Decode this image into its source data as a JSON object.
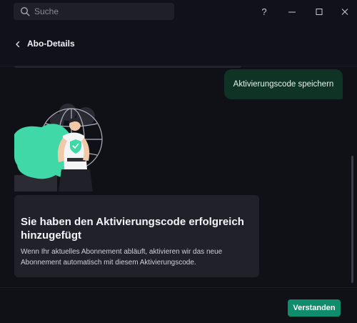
{
  "search": {
    "placeholder": "Suche",
    "icon": "search-icon"
  },
  "window_controls": {
    "help": "?",
    "minimize": "–",
    "maximize": "□",
    "close": "×"
  },
  "header": {
    "title": "Abo-Details",
    "back_icon": "chevron-left-icon"
  },
  "chat": {
    "bubble_text": "Aktivierungscode speichern"
  },
  "card": {
    "title": "Sie haben den Aktivierungscode erfolgreich hinzugefügt",
    "body": "Wenn Ihr aktuelles Abonnement abläuft, aktivieren wir das neue Abonnement automatisch mit diesem Aktivierungscode."
  },
  "footer": {
    "confirm_label": "Verstanden"
  },
  "colors": {
    "background": "#101017",
    "card": "#21212a",
    "bubble": "#0f3324",
    "accent": "#0f8c6c",
    "illustration_green": "#3fd8a6"
  }
}
